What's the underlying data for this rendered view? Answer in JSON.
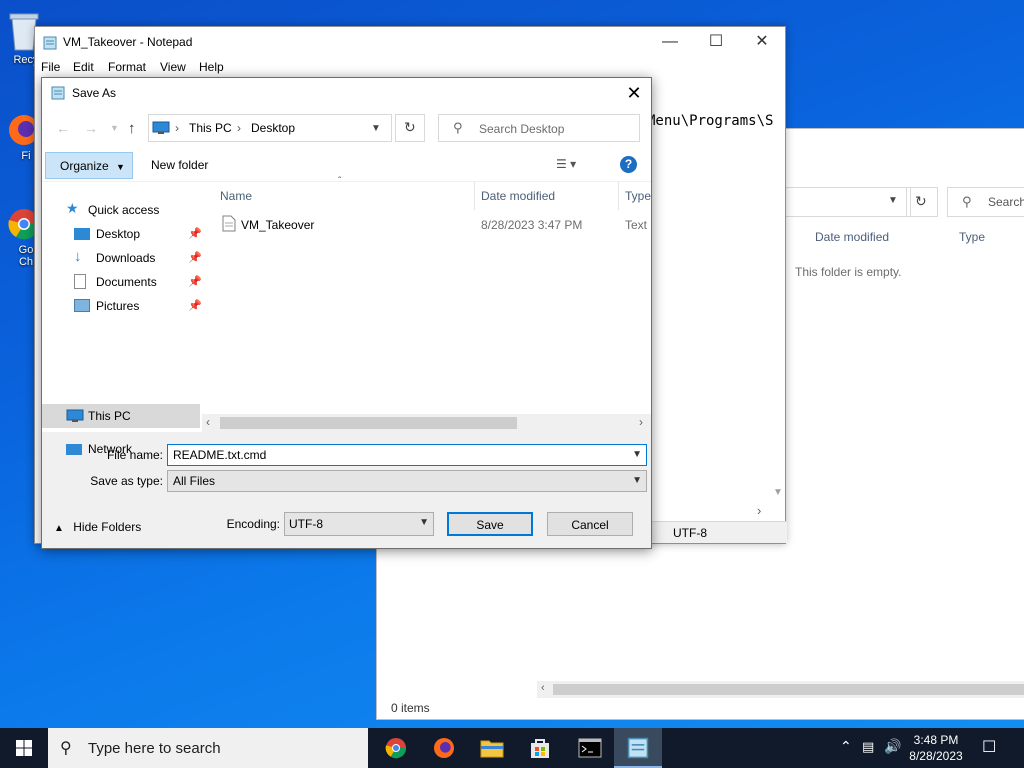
{
  "desktop": {
    "icons": [
      {
        "label": "Recy"
      },
      {
        "label": "Fi"
      },
      {
        "label": "Go"
      },
      {
        "label": "Ch"
      }
    ]
  },
  "explorer": {
    "search_placeholder": "Search",
    "col_date": "Date modified",
    "col_type": "Type",
    "empty_text": "This folder is empty.",
    "items_count": "0 items"
  },
  "notepad": {
    "title": "VM_Takeover - Notepad",
    "menu": [
      "File",
      "Edit",
      "Format",
      "View",
      "Help"
    ],
    "text_fragment": "Menu\\Programs\\S",
    "encoding_status": "UTF-8"
  },
  "dialog": {
    "title": "Save As",
    "address": {
      "this_pc": "This PC",
      "desktop": "Desktop"
    },
    "search_placeholder": "Search Desktop",
    "organize": "Organize",
    "new_folder": "New folder",
    "nav": {
      "quick_access": "Quick access",
      "desktop": "Desktop",
      "downloads": "Downloads",
      "documents": "Documents",
      "pictures": "Pictures",
      "this_pc": "This PC",
      "network": "Network"
    },
    "columns": {
      "name": "Name",
      "date": "Date modified",
      "type": "Type"
    },
    "files": [
      {
        "name": "VM_Takeover",
        "date": "8/28/2023 3:47 PM",
        "type": "Text D"
      }
    ],
    "file_name_label": "File name:",
    "file_name_value": "README.txt.cmd",
    "save_type_label": "Save as type:",
    "save_type_value": "All Files",
    "hide_folders": "Hide Folders",
    "encoding_label": "Encoding:",
    "encoding_value": "UTF-8",
    "save_button": "Save",
    "cancel_button": "Cancel"
  },
  "taskbar": {
    "search_placeholder": "Type here to search",
    "time": "3:48 PM",
    "date": "8/28/2023"
  },
  "colors": {
    "accent": "#0078d7",
    "organize_bg": "#cce4f7",
    "taskbar": "#101a2a"
  }
}
